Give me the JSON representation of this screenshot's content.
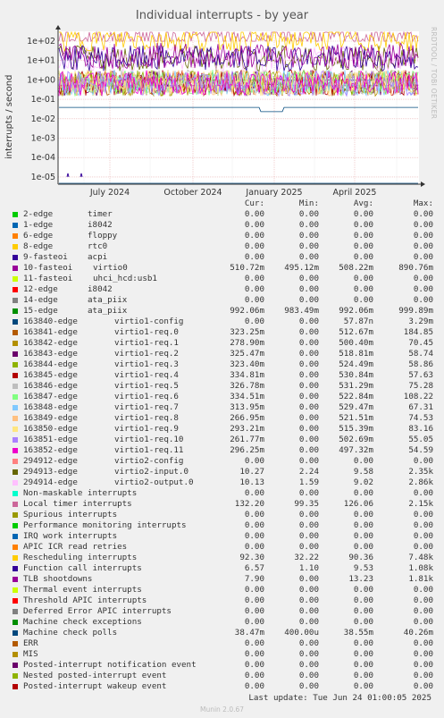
{
  "title": "Individual interrupts - by year",
  "side_credit": "RRDTOOL / TOBI OETIKER",
  "last_update": "Last update: Tue Jun 24 01:00:05 2025",
  "munin_version": "Munin 2.0.67",
  "chart_data": {
    "type": "line",
    "ylabel": "interrupts / second",
    "yscale": "log",
    "ylim": [
      1e-05,
      100
    ],
    "y_ticks": [
      "1e+02",
      "1e+01",
      "1e+00",
      "1e-01",
      "1e-02",
      "1e-03",
      "1e-04",
      "1e-05"
    ],
    "x_ticks": [
      "July 2024",
      "October 2024",
      "January 2025",
      "April 2025"
    ],
    "grid": true,
    "columns": [
      "Cur:",
      "Min:",
      "Avg:",
      "Max:"
    ],
    "series": [
      {
        "name": "2-edge",
        "device": "timer",
        "color": "#00cc00",
        "cur": "0.00",
        "min": "0.00",
        "avg": "0.00",
        "max": "0.00"
      },
      {
        "name": "1-edge",
        "device": "i8042",
        "color": "#0066b3",
        "cur": "0.00",
        "min": "0.00",
        "avg": "0.00",
        "max": "0.00"
      },
      {
        "name": "6-edge",
        "device": "floppy",
        "color": "#ff8000",
        "cur": "0.00",
        "min": "0.00",
        "avg": "0.00",
        "max": "0.00"
      },
      {
        "name": "8-edge",
        "device": "rtc0",
        "color": "#ffcc00",
        "cur": "0.00",
        "min": "0.00",
        "avg": "0.00",
        "max": "0.00"
      },
      {
        "name": "9-fasteoi",
        "device": "acpi",
        "color": "#330099",
        "cur": "0.00",
        "min": "0.00",
        "avg": "0.00",
        "max": "0.00"
      },
      {
        "name": "10-fasteoi",
        "device": "virtio0",
        "color": "#990099",
        "cur": "510.72m",
        "min": "495.12m",
        "avg": "508.22m",
        "max": "890.76m"
      },
      {
        "name": "11-fasteoi",
        "device": "uhci_hcd:usb1",
        "color": "#ccff00",
        "cur": "0.00",
        "min": "0.00",
        "avg": "0.00",
        "max": "0.00"
      },
      {
        "name": "12-edge",
        "device": "i8042",
        "color": "#ff0000",
        "cur": "0.00",
        "min": "0.00",
        "avg": "0.00",
        "max": "0.00"
      },
      {
        "name": "14-edge",
        "device": "ata_piix",
        "color": "#808080",
        "cur": "0.00",
        "min": "0.00",
        "avg": "0.00",
        "max": "0.00"
      },
      {
        "name": "15-edge",
        "device": "ata_piix",
        "color": "#008f00",
        "cur": "992.06m",
        "min": "983.49m",
        "avg": "992.06m",
        "max": "999.89m"
      },
      {
        "name": "163840-edge",
        "device": "virtio1-config",
        "color": "#00487d",
        "cur": "0.00",
        "min": "0.00",
        "avg": "57.87n",
        "max": "3.29m"
      },
      {
        "name": "163841-edge",
        "device": "virtio1-req.0",
        "color": "#b35a00",
        "cur": "323.25m",
        "min": "0.00",
        "avg": "512.67m",
        "max": "184.85"
      },
      {
        "name": "163842-edge",
        "device": "virtio1-req.1",
        "color": "#b38f00",
        "cur": "278.90m",
        "min": "0.00",
        "avg": "500.40m",
        "max": "70.45"
      },
      {
        "name": "163843-edge",
        "device": "virtio1-req.2",
        "color": "#6b006b",
        "cur": "325.47m",
        "min": "0.00",
        "avg": "518.81m",
        "max": "58.74"
      },
      {
        "name": "163844-edge",
        "device": "virtio1-req.3",
        "color": "#8fb300",
        "cur": "323.40m",
        "min": "0.00",
        "avg": "524.49m",
        "max": "58.86"
      },
      {
        "name": "163845-edge",
        "device": "virtio1-req.4",
        "color": "#b30000",
        "cur": "334.81m",
        "min": "0.00",
        "avg": "530.84m",
        "max": "57.63"
      },
      {
        "name": "163846-edge",
        "device": "virtio1-req.5",
        "color": "#bebebe",
        "cur": "326.78m",
        "min": "0.00",
        "avg": "531.29m",
        "max": "75.28"
      },
      {
        "name": "163847-edge",
        "device": "virtio1-req.6",
        "color": "#80ff80",
        "cur": "334.51m",
        "min": "0.00",
        "avg": "522.84m",
        "max": "108.22"
      },
      {
        "name": "163848-edge",
        "device": "virtio1-req.7",
        "color": "#80c9ff",
        "cur": "313.95m",
        "min": "0.00",
        "avg": "529.47m",
        "max": "67.31"
      },
      {
        "name": "163849-edge",
        "device": "virtio1-req.8",
        "color": "#ffc080",
        "cur": "266.95m",
        "min": "0.00",
        "avg": "521.51m",
        "max": "74.53"
      },
      {
        "name": "163850-edge",
        "device": "virtio1-req.9",
        "color": "#ffe680",
        "cur": "293.21m",
        "min": "0.00",
        "avg": "515.39m",
        "max": "83.16"
      },
      {
        "name": "163851-edge",
        "device": "virtio1-req.10",
        "color": "#aa80ff",
        "cur": "261.77m",
        "min": "0.00",
        "avg": "502.69m",
        "max": "55.05"
      },
      {
        "name": "163852-edge",
        "device": "virtio1-req.11",
        "color": "#ee00cc",
        "cur": "296.25m",
        "min": "0.00",
        "avg": "497.32m",
        "max": "54.59"
      },
      {
        "name": "294912-edge",
        "device": "virtio2-config",
        "color": "#ff8080",
        "cur": "0.00",
        "min": "0.00",
        "avg": "0.00",
        "max": "0.00"
      },
      {
        "name": "294913-edge",
        "device": "virtio2-input.0",
        "color": "#666600",
        "cur": "10.27",
        "min": "2.24",
        "avg": "9.58",
        "max": "2.35k"
      },
      {
        "name": "294914-edge",
        "device": "virtio2-output.0",
        "color": "#ffbfff",
        "cur": "10.13",
        "min": "1.59",
        "avg": "9.02",
        "max": "2.86k"
      },
      {
        "name": "Non-maskable interrupts",
        "device": "",
        "color": "#00ffcc",
        "cur": "0.00",
        "min": "0.00",
        "avg": "0.00",
        "max": "0.00"
      },
      {
        "name": "Local timer interrupts",
        "device": "",
        "color": "#cc6699",
        "cur": "132.20",
        "min": "99.35",
        "avg": "126.06",
        "max": "2.15k"
      },
      {
        "name": "Spurious interrupts",
        "device": "",
        "color": "#999900",
        "cur": "0.00",
        "min": "0.00",
        "avg": "0.00",
        "max": "0.00"
      },
      {
        "name": "Performance monitoring interrupts",
        "device": "",
        "color": "#00cc00",
        "cur": "0.00",
        "min": "0.00",
        "avg": "0.00",
        "max": "0.00"
      },
      {
        "name": "IRQ work interrupts",
        "device": "",
        "color": "#0066b3",
        "cur": "0.00",
        "min": "0.00",
        "avg": "0.00",
        "max": "0.00"
      },
      {
        "name": "APIC ICR read retries",
        "device": "",
        "color": "#ff8000",
        "cur": "0.00",
        "min": "0.00",
        "avg": "0.00",
        "max": "0.00"
      },
      {
        "name": "Rescheduling interrupts",
        "device": "",
        "color": "#ffcc00",
        "cur": "92.30",
        "min": "32.22",
        "avg": "90.36",
        "max": "7.48k"
      },
      {
        "name": "Function call interrupts",
        "device": "",
        "color": "#330099",
        "cur": "6.57",
        "min": "1.10",
        "avg": "9.53",
        "max": "1.08k"
      },
      {
        "name": "TLB shootdowns",
        "device": "",
        "color": "#990099",
        "cur": "7.90",
        "min": "0.00",
        "avg": "13.23",
        "max": "1.81k"
      },
      {
        "name": "Thermal event interrupts",
        "device": "",
        "color": "#ccff00",
        "cur": "0.00",
        "min": "0.00",
        "avg": "0.00",
        "max": "0.00"
      },
      {
        "name": "Threshold APIC interrupts",
        "device": "",
        "color": "#ff0000",
        "cur": "0.00",
        "min": "0.00",
        "avg": "0.00",
        "max": "0.00"
      },
      {
        "name": "Deferred Error APIC interrupts",
        "device": "",
        "color": "#808080",
        "cur": "0.00",
        "min": "0.00",
        "avg": "0.00",
        "max": "0.00"
      },
      {
        "name": "Machine check exceptions",
        "device": "",
        "color": "#008f00",
        "cur": "0.00",
        "min": "0.00",
        "avg": "0.00",
        "max": "0.00"
      },
      {
        "name": "Machine check polls",
        "device": "",
        "color": "#00487d",
        "cur": "38.47m",
        "min": "400.00u",
        "avg": "38.55m",
        "max": "40.26m"
      },
      {
        "name": "ERR",
        "device": "",
        "color": "#b35a00",
        "cur": "0.00",
        "min": "0.00",
        "avg": "0.00",
        "max": "0.00"
      },
      {
        "name": "MIS",
        "device": "",
        "color": "#b38f00",
        "cur": "0.00",
        "min": "0.00",
        "avg": "0.00",
        "max": "0.00"
      },
      {
        "name": "Posted-interrupt notification event",
        "device": "",
        "color": "#6b006b",
        "cur": "0.00",
        "min": "0.00",
        "avg": "0.00",
        "max": "0.00"
      },
      {
        "name": "Nested posted-interrupt event",
        "device": "",
        "color": "#8fb300",
        "cur": "0.00",
        "min": "0.00",
        "avg": "0.00",
        "max": "0.00"
      },
      {
        "name": "Posted-interrupt wakeup event",
        "device": "",
        "color": "#b30000",
        "cur": "0.00",
        "min": "0.00",
        "avg": "0.00",
        "max": "0.00"
      }
    ]
  }
}
